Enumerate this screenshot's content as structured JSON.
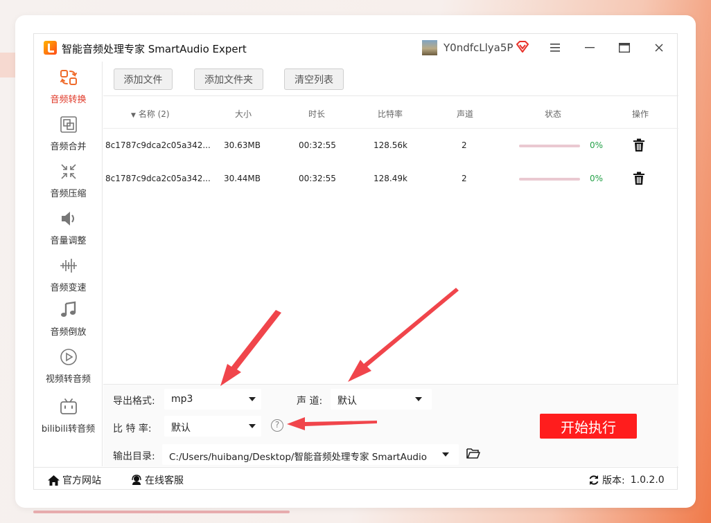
{
  "app": {
    "title": "智能音频处理专家 SmartAudio Expert",
    "username": "Y0ndfcLlya5P",
    "accent_color": "#e03a2a"
  },
  "window_controls": {
    "menu_icon": "hamburger-icon",
    "minimize_icon": "minimize-icon",
    "maximize_icon": "maximize-icon",
    "close_icon": "close-icon"
  },
  "sidebar": {
    "items": [
      {
        "label": "音频转换",
        "icon": "convert-icon",
        "active": true
      },
      {
        "label": "音频合并",
        "icon": "merge-icon"
      },
      {
        "label": "音频压缩",
        "icon": "compress-icon"
      },
      {
        "label": "音量调整",
        "icon": "volume-icon"
      },
      {
        "label": "音频变速",
        "icon": "speed-icon"
      },
      {
        "label": "音频倒放",
        "icon": "music-note-icon"
      },
      {
        "label": "视频转音频",
        "icon": "play-circle-icon"
      },
      {
        "label": "bilibili转音频",
        "icon": "bilibili-icon"
      }
    ]
  },
  "toolbar": {
    "add_file": "添加文件",
    "add_folder": "添加文件夹",
    "clear_list": "清空列表"
  },
  "table": {
    "columns": {
      "name": "名称 (2)",
      "size": "大小",
      "duration": "时长",
      "bitrate": "比特率",
      "channels": "声道",
      "status": "状态",
      "action": "操作"
    },
    "rows": [
      {
        "name": "8c1787c9dca2c05a342...",
        "size": "30.63MB",
        "duration": "00:32:55",
        "bitrate": "128.56k",
        "channels": "2",
        "progress_percent": 0,
        "progress_text": "0%"
      },
      {
        "name": "8c1787c9dca2c05a342...",
        "size": "30.44MB",
        "duration": "00:32:55",
        "bitrate": "128.49k",
        "channels": "2",
        "progress_percent": 0,
        "progress_text": "0%"
      }
    ]
  },
  "settings": {
    "format_label": "导出格式:",
    "format_value": "mp3",
    "channel_label": "声 道:",
    "channel_value": "默认",
    "bitrate_label": "比 特 率:",
    "bitrate_value": "默认",
    "help_glyph": "?",
    "output_label": "输出目录:",
    "output_value": "C:/Users/huibang/Desktop/智能音频处理专家 SmartAudio",
    "start_button": "开始执行"
  },
  "footer": {
    "website": "官方网站",
    "support": "在线客服",
    "version_label": "版本:",
    "version": "1.0.2.0"
  },
  "annotation_color": "#f0454b"
}
